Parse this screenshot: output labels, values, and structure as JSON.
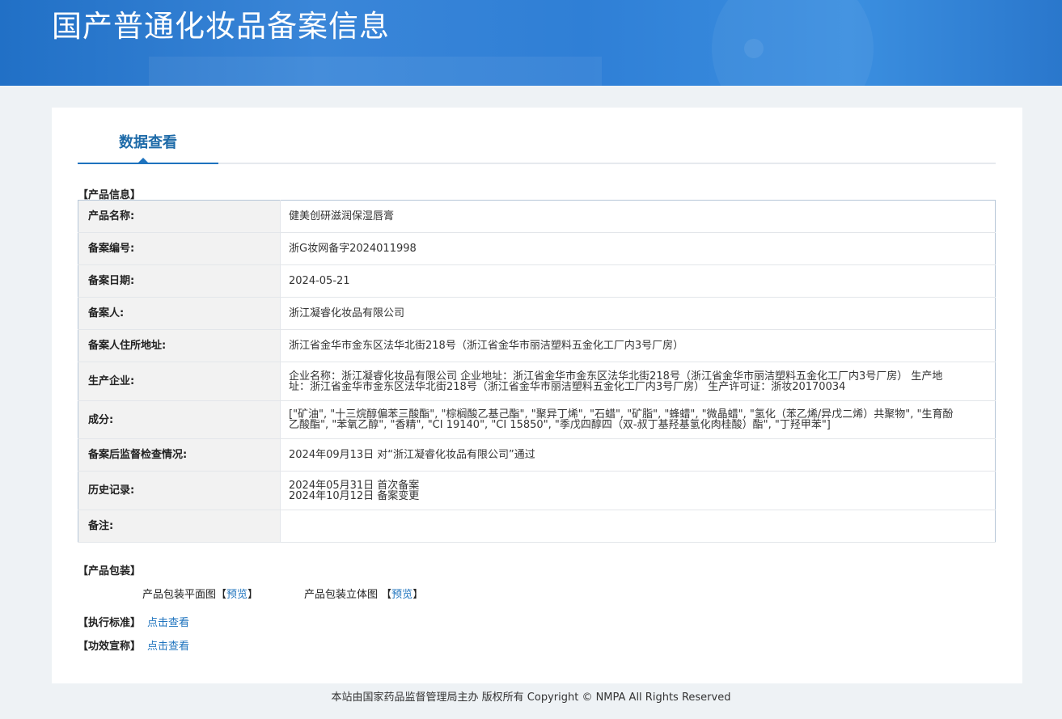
{
  "header": {
    "title": "国产普通化妆品备案信息"
  },
  "tab": {
    "label": "数据查看"
  },
  "sections": {
    "product_info": "【产品信息】",
    "packaging": "【产品包装】",
    "standard": "【执行标准】",
    "efficacy": "【功效宣称】"
  },
  "product": {
    "rows": [
      {
        "label": "产品名称:",
        "value": "健美创研滋润保湿唇膏"
      },
      {
        "label": "备案编号:",
        "value": "浙G妆网备字2024011998"
      },
      {
        "label": "备案日期:",
        "value": "2024-05-21"
      },
      {
        "label": "备案人:",
        "value": "浙江凝睿化妆品有限公司"
      },
      {
        "label": "备案人住所地址:",
        "value": "浙江省金华市金东区法华北街218号（浙江省金华市丽洁塑料五金化工厂内3号厂房）"
      },
      {
        "label": "生产企业:",
        "value": "企业名称：浙江凝睿化妆品有限公司 企业地址：浙江省金华市金东区法华北街218号（浙江省金华市丽洁塑料五金化工厂内3号厂房） 生产地址：浙江省金华市金东区法华北街218号（浙江省金华市丽洁塑料五金化工厂内3号厂房） 生产许可证：浙妆20170034"
      },
      {
        "label": "成分:",
        "value": "[\"矿油\", \"十三烷醇偏苯三酸酯\", \"棕榈酸乙基己酯\", \"聚异丁烯\", \"石蜡\", \"矿脂\", \"蜂蜡\", \"微晶蜡\", \"氢化（苯乙烯/异戊二烯）共聚物\", \"生育酚乙酸酯\", \"苯氧乙醇\", \"香精\", \"CI 19140\", \"CI 15850\", \"季戊四醇四（双-叔丁基羟基氢化肉桂酸）酯\", \"丁羟甲苯\"]"
      },
      {
        "label": "备案后监督检查情况:",
        "value": "2024年09月13日 对“浙江凝睿化妆品有限公司”通过"
      },
      {
        "label": "历史记录:",
        "value_lines": [
          "2024年05月31日 首次备案",
          "2024年10月12日 备案变更"
        ]
      },
      {
        "label": "备注:",
        "value": ""
      }
    ]
  },
  "packaging": {
    "flat_label": "产品包装平面图",
    "solid_label": "产品包装立体图",
    "preview": "预览",
    "bracket_open": "【",
    "bracket_close": "】"
  },
  "links": {
    "view": "点击查看"
  },
  "footer": {
    "text": "本站由国家药品监督管理局主办 版权所有 Copyright © NMPA All Rights Reserved"
  }
}
